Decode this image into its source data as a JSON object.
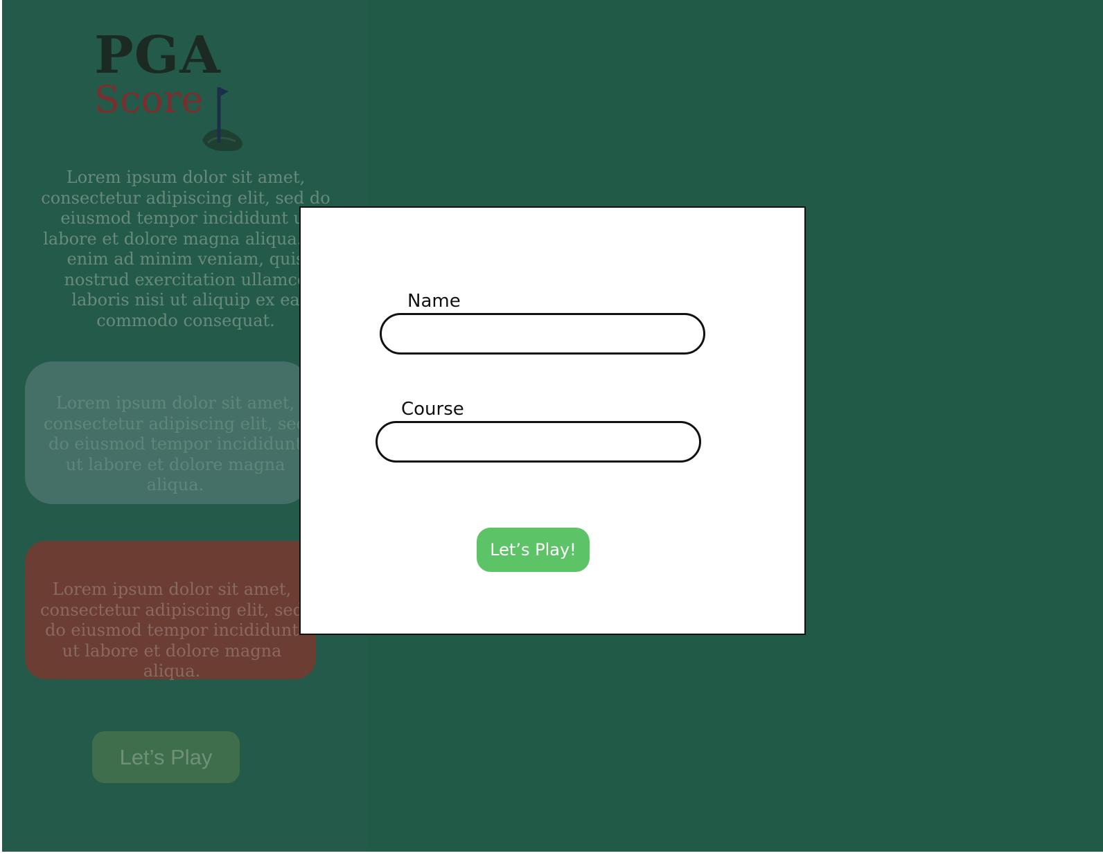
{
  "logo": {
    "title": "PGA",
    "subtitle": "Score"
  },
  "intro": {
    "text": "Lorem ipsum dolor sit amet, consectetur adipiscing elit, sed do eiusmod tempor incididunt ut labore et dolore magna aliqua. Ut enim ad minim veniam, quis nostrud exercitation ullamco laboris nisi ut aliquip ex ea commodo consequat."
  },
  "cards": {
    "teal_text": "Lorem ipsum dolor sit amet, consectetur adipiscing elit, sed do eiusmod tempor incididunt ut labore et dolore magna aliqua.",
    "red_text": "Lorem ipsum dolor sit amet, consectetur adipiscing elit, sed do eiusmod tempor incididunt ut labore et dolore magna aliqua."
  },
  "background_button": {
    "label": "Let’s Play"
  },
  "modal": {
    "name_label": "Name",
    "name_value": "",
    "course_label": "Course",
    "course_value": "",
    "submit_label": "Let’s Play!"
  },
  "colors": {
    "page_bg": "#225a48",
    "submit_green": "#5cc366",
    "teal_card": "#457068",
    "red_card": "#6b3d33"
  }
}
